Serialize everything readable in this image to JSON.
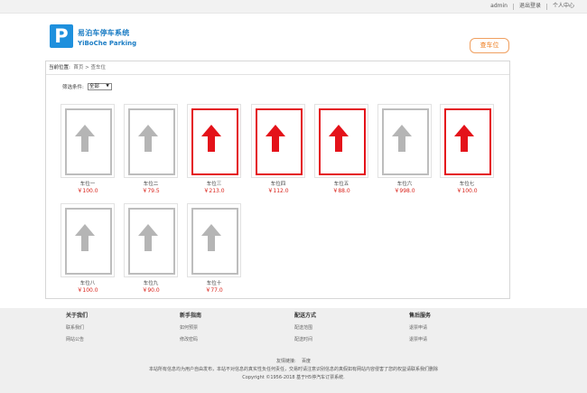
{
  "topbar": {
    "user": "admin",
    "logout": "退出登录",
    "profile": "个人中心"
  },
  "header": {
    "logo_letter": "P",
    "logo_cn": "易泊车停车系统",
    "logo_en": "YiBoChe  Parking",
    "find_button": "查车位"
  },
  "breadcrumb": {
    "label": "当前位置:",
    "home": "首页",
    "sep": ">",
    "current": "查车位"
  },
  "filter": {
    "label": "筛选条件:",
    "selected": "全部"
  },
  "spots": [
    {
      "name": "车位一",
      "price": "￥100.0",
      "status": "gray"
    },
    {
      "name": "车位二",
      "price": "￥79.5",
      "status": "gray"
    },
    {
      "name": "车位三",
      "price": "￥213.0",
      "status": "red"
    },
    {
      "name": "车位四",
      "price": "￥112.0",
      "status": "red"
    },
    {
      "name": "车位五",
      "price": "￥88.0",
      "status": "red"
    },
    {
      "name": "车位六",
      "price": "￥998.0",
      "status": "gray"
    },
    {
      "name": "车位七",
      "price": "￥100.0",
      "status": "red"
    },
    {
      "name": "车位八",
      "price": "￥100.0",
      "status": "gray"
    },
    {
      "name": "车位九",
      "price": "￥90.0",
      "status": "gray"
    },
    {
      "name": "车位十",
      "price": "￥77.0",
      "status": "gray"
    }
  ],
  "colors": {
    "gray": "#b5b5b5",
    "red": "#e4121a",
    "accent": "#ef7d1e",
    "brand": "#1e90dd"
  },
  "footer": {
    "columns": [
      {
        "title": "关于我们",
        "links": [
          "联系我们",
          "网站公告"
        ]
      },
      {
        "title": "新手指南",
        "links": [
          "如何预票",
          "修改密码"
        ]
      },
      {
        "title": "配送方式",
        "links": [
          "配送范围",
          "配送时间"
        ]
      },
      {
        "title": "售后服务",
        "links": [
          "退票申请",
          "退票申请"
        ]
      }
    ],
    "friend_label": "友情链接:",
    "friend_link": "百度",
    "disclaimer": "本站所有信息均为用户自由发布，本站不对信息的真实性负任何责任，交易时请注意识别信息的真假如有网站内容侵害了您的权益请联系我们删除",
    "copyright": "Copyright ©1956-2018 基于H5停汽车订票系统."
  }
}
